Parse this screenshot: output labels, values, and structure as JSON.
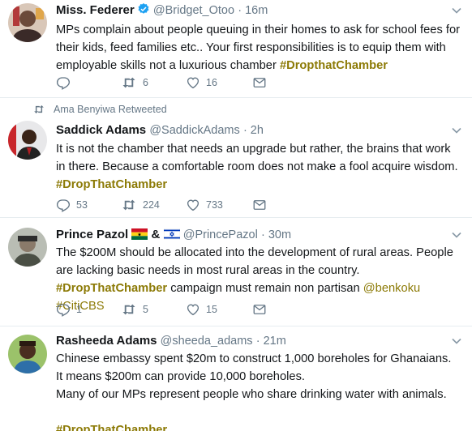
{
  "tweets": [
    {
      "name": "Miss. Federer",
      "handle": "@Bridget_Otoo",
      "time": "· 16m",
      "text": [
        "MPs complain about people queuing in their homes to ask for school fees for their kids, feed families etc.. Your first responsibilities is to equip them with employable skills not a luxurious chamber ",
        "#DropthatChamber"
      ],
      "replies": "",
      "retweets": "6",
      "likes": "16"
    },
    {
      "retweeted_by": "Ama Benyiwa Retweeted",
      "name": "Saddick Adams",
      "handle": "@SaddickAdams",
      "time": "· 2h",
      "text": [
        "It is not the chamber that needs an upgrade but rather, the brains that work in there. Because a comfortable room does not make a fool acquire wisdom.",
        "#DropThatChamber"
      ],
      "replies": "53",
      "retweets": "224",
      "likes": "733"
    },
    {
      "name": "Prince Pazol",
      "name_sep": "&",
      "handle": "@PrincePazol",
      "time": "· 30m",
      "text": [
        "The $200M should be allocated into the development of rural areas. People are lacking basic needs in most rural areas in the country. ",
        "#DropThatChamber",
        " campaign must remain non partisan ",
        "@benkoku",
        " ",
        "#CitiCBS"
      ],
      "replies": "1",
      "retweets": "5",
      "likes": "15"
    },
    {
      "name": "Rasheeda Adams",
      "handle": "@sheeda_adams",
      "time": "· 21m",
      "text": [
        "Chinese embassy spent $20m to construct 1,000 boreholes for Ghanaians.",
        "It means $200m can provide 10,000 boreholes.",
        "Many of our MPs represent people who share drinking water with animals.",
        "#DropThatChamber"
      ]
    }
  ],
  "colors": {
    "hashtag": "#8c7a06",
    "muted": "#657786",
    "divider": "#e6ecf0",
    "verified": "#1da1f2"
  },
  "icons": [
    "reply-icon",
    "retweet-icon",
    "like-icon",
    "message-icon",
    "caret-down-icon",
    "verified-icon",
    "ghana-flag-icon",
    "israel-flag-icon"
  ]
}
